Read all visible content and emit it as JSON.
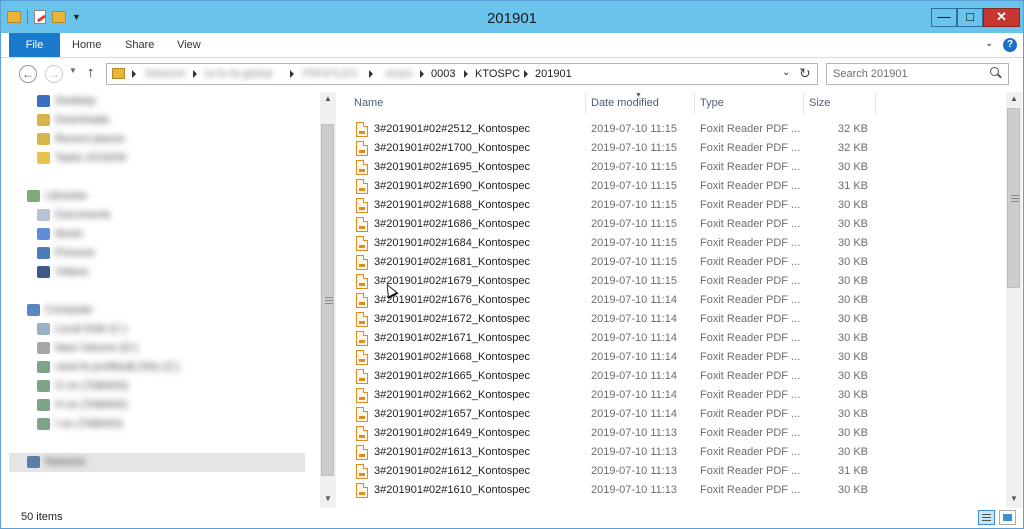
{
  "window": {
    "title": "201901"
  },
  "ribbon": {
    "tabs": [
      "File",
      "Home",
      "Share",
      "View"
    ]
  },
  "address": {
    "hidden_crumbs": [
      "Network",
      "ta-fs-fa-global",
      "PROFILES",
      "share"
    ],
    "crumbs": [
      "0003",
      "KTOSPC",
      "201901"
    ]
  },
  "search": {
    "placeholder": "Search 201901"
  },
  "nav_pane": {
    "items": [
      "Desktop",
      "Downloads",
      "Recent places",
      "Tasks 2016/09",
      "Libraries",
      "Documents",
      "Music",
      "Pictures",
      "Videos",
      "Computer",
      "Local Disk (C:)",
      "New Volume (D:)",
      "rand-fs-profiles$ (\\\\fs) (Z:)",
      "G on (TAB400)",
      "H on (TAB400)",
      "I on (TAB400)",
      "Network"
    ]
  },
  "columns": {
    "name": "Name",
    "date": "Date modified",
    "type": "Type",
    "size": "Size"
  },
  "files": [
    {
      "name": "3#201901#02#2512_Kontospec",
      "date": "2019-07-10 11:15",
      "type": "Foxit Reader PDF ...",
      "size": "32 KB"
    },
    {
      "name": "3#201901#02#1700_Kontospec",
      "date": "2019-07-10 11:15",
      "type": "Foxit Reader PDF ...",
      "size": "32 KB"
    },
    {
      "name": "3#201901#02#1695_Kontospec",
      "date": "2019-07-10 11:15",
      "type": "Foxit Reader PDF ...",
      "size": "30 KB"
    },
    {
      "name": "3#201901#02#1690_Kontospec",
      "date": "2019-07-10 11:15",
      "type": "Foxit Reader PDF ...",
      "size": "31 KB"
    },
    {
      "name": "3#201901#02#1688_Kontospec",
      "date": "2019-07-10 11:15",
      "type": "Foxit Reader PDF ...",
      "size": "30 KB"
    },
    {
      "name": "3#201901#02#1686_Kontospec",
      "date": "2019-07-10 11:15",
      "type": "Foxit Reader PDF ...",
      "size": "30 KB"
    },
    {
      "name": "3#201901#02#1684_Kontospec",
      "date": "2019-07-10 11:15",
      "type": "Foxit Reader PDF ...",
      "size": "30 KB"
    },
    {
      "name": "3#201901#02#1681_Kontospec",
      "date": "2019-07-10 11:15",
      "type": "Foxit Reader PDF ...",
      "size": "30 KB"
    },
    {
      "name": "3#201901#02#1679_Kontospec",
      "date": "2019-07-10 11:15",
      "type": "Foxit Reader PDF ...",
      "size": "30 KB"
    },
    {
      "name": "3#201901#02#1676_Kontospec",
      "date": "2019-07-10 11:14",
      "type": "Foxit Reader PDF ...",
      "size": "30 KB"
    },
    {
      "name": "3#201901#02#1672_Kontospec",
      "date": "2019-07-10 11:14",
      "type": "Foxit Reader PDF ...",
      "size": "30 KB"
    },
    {
      "name": "3#201901#02#1671_Kontospec",
      "date": "2019-07-10 11:14",
      "type": "Foxit Reader PDF ...",
      "size": "30 KB"
    },
    {
      "name": "3#201901#02#1668_Kontospec",
      "date": "2019-07-10 11:14",
      "type": "Foxit Reader PDF ...",
      "size": "30 KB"
    },
    {
      "name": "3#201901#02#1665_Kontospec",
      "date": "2019-07-10 11:14",
      "type": "Foxit Reader PDF ...",
      "size": "30 KB"
    },
    {
      "name": "3#201901#02#1662_Kontospec",
      "date": "2019-07-10 11:14",
      "type": "Foxit Reader PDF ...",
      "size": "30 KB"
    },
    {
      "name": "3#201901#02#1657_Kontospec",
      "date": "2019-07-10 11:14",
      "type": "Foxit Reader PDF ...",
      "size": "30 KB"
    },
    {
      "name": "3#201901#02#1649_Kontospec",
      "date": "2019-07-10 11:13",
      "type": "Foxit Reader PDF ...",
      "size": "30 KB"
    },
    {
      "name": "3#201901#02#1613_Kontospec",
      "date": "2019-07-10 11:13",
      "type": "Foxit Reader PDF ...",
      "size": "30 KB"
    },
    {
      "name": "3#201901#02#1612_Kontospec",
      "date": "2019-07-10 11:13",
      "type": "Foxit Reader PDF ...",
      "size": "31 KB"
    },
    {
      "name": "3#201901#02#1610_Kontospec",
      "date": "2019-07-10 11:13",
      "type": "Foxit Reader PDF ...",
      "size": "30 KB"
    }
  ],
  "status": {
    "count": "50 items"
  },
  "colors": {
    "titlebar": "#69c3eb",
    "file_tab": "#1979ca",
    "close": "#c7372f",
    "pdf_icon": "#e48a1c"
  },
  "icons": {
    "file": "pdf-file-icon",
    "folder": "folder-icon",
    "search": "search-icon"
  }
}
